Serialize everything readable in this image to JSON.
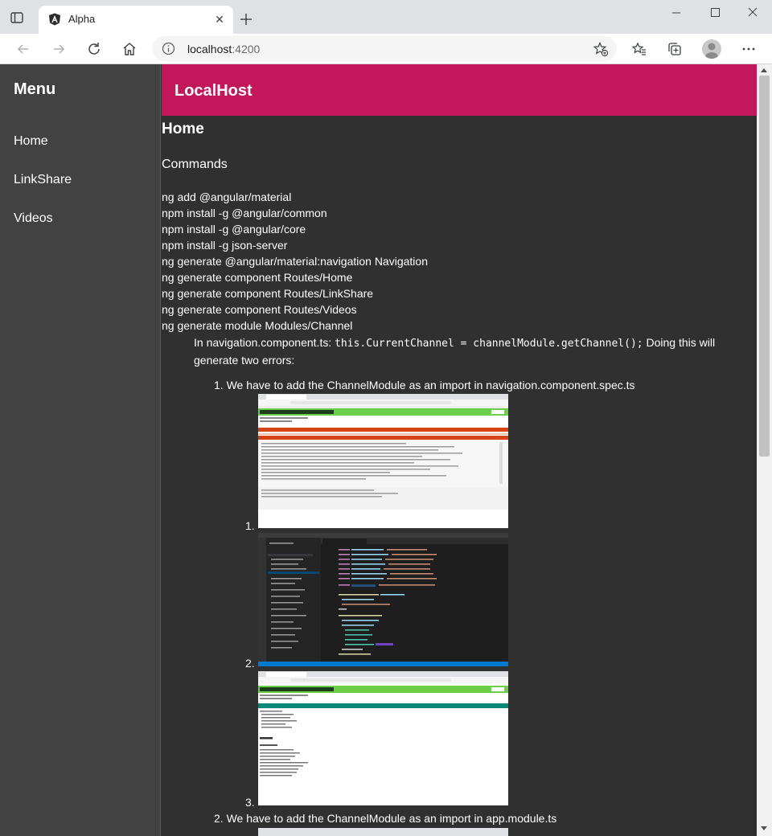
{
  "browser": {
    "tab_title": "Alpha",
    "url_host": "localhost",
    "url_port": ":4200"
  },
  "sidenav": {
    "title": "Menu",
    "items": [
      {
        "label": "Home"
      },
      {
        "label": "LinkShare"
      },
      {
        "label": "Videos"
      }
    ]
  },
  "header": {
    "title": "LocalHost",
    "color": "#c2185b"
  },
  "content": {
    "heading": "Home",
    "subheading": "Commands",
    "commands": [
      "ng add @angular/material",
      "npm install -g @angular/common",
      "npm install -g @angular/core",
      "npm install -g json-server",
      "ng generate @angular/material:navigation Navigation",
      "ng generate component Routes/Home",
      "ng generate component Routes/LinkShare",
      "ng generate component Routes/Videos",
      "ng generate module Modules/Channel"
    ],
    "note_prefix": "In navigation.component.ts: ",
    "note_code": "this.CurrentChannel = channelModule.getChannel();",
    "note_suffix": " Doing this will generate two errors:",
    "errors": [
      {
        "number": "1.",
        "text": "We have to add the ChannelModule as an import in navigation.component.spec.ts"
      },
      {
        "number": "2.",
        "text": "We have to add the ChannelModule as an import in app.module.ts"
      }
    ],
    "sub_items": [
      "1.",
      "2.",
      "3."
    ],
    "screenshot_icons": [
      "karma-test-screenshot",
      "vscode-editor-screenshot",
      "karma-test-screenshot"
    ]
  },
  "theme": {
    "background": "#303030",
    "sidenav": "#424242",
    "accent": "#c2185b"
  }
}
